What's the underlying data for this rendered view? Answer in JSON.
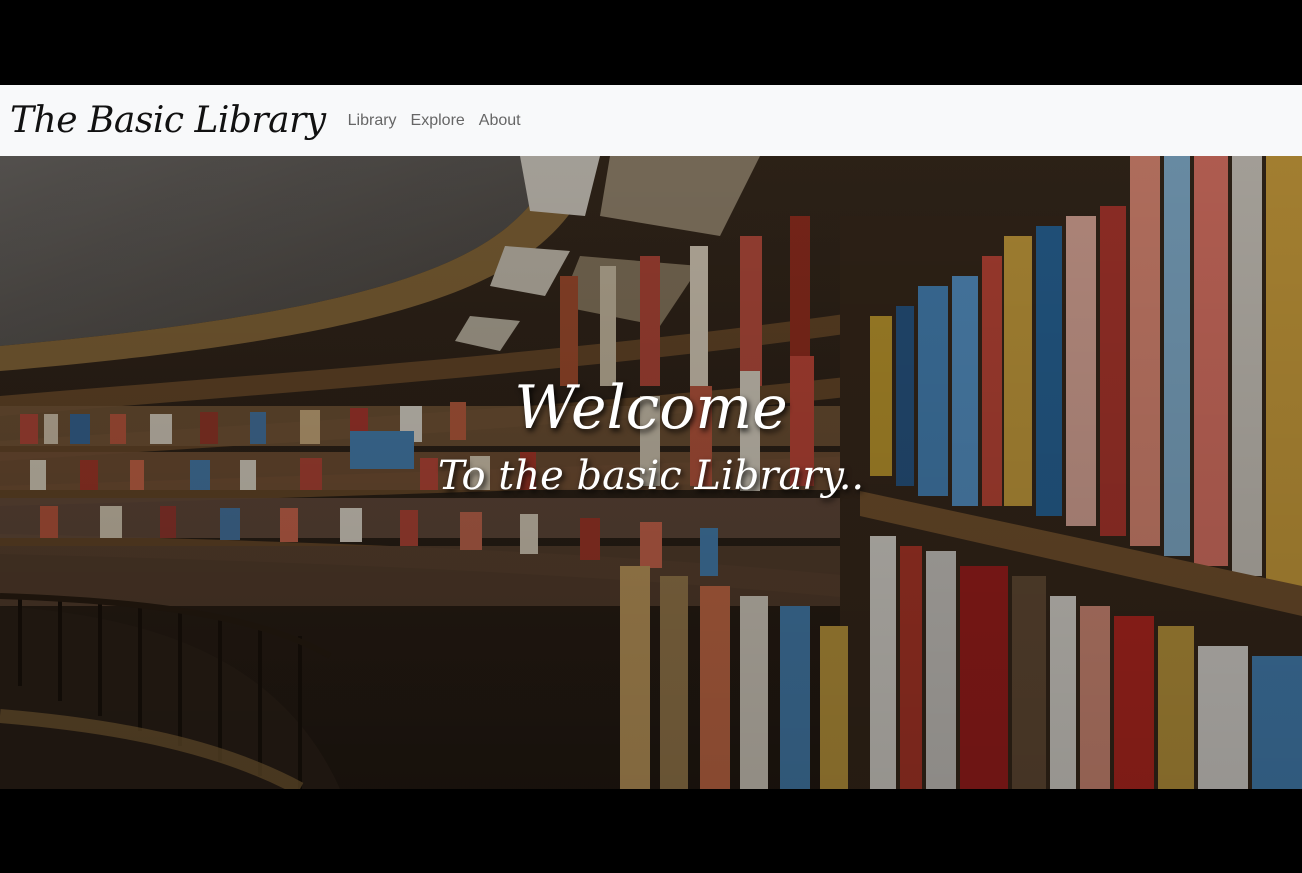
{
  "navbar": {
    "brand": "The Basic Library",
    "links": [
      "Library",
      "Explore",
      "About"
    ]
  },
  "hero": {
    "title": "Welcome",
    "subtitle": "To the basic Library.."
  },
  "colors": {
    "navbar_bg": "#f8f9fa",
    "nav_link": "#666666",
    "hero_text": "#ffffff",
    "letterbox": "#000000"
  }
}
